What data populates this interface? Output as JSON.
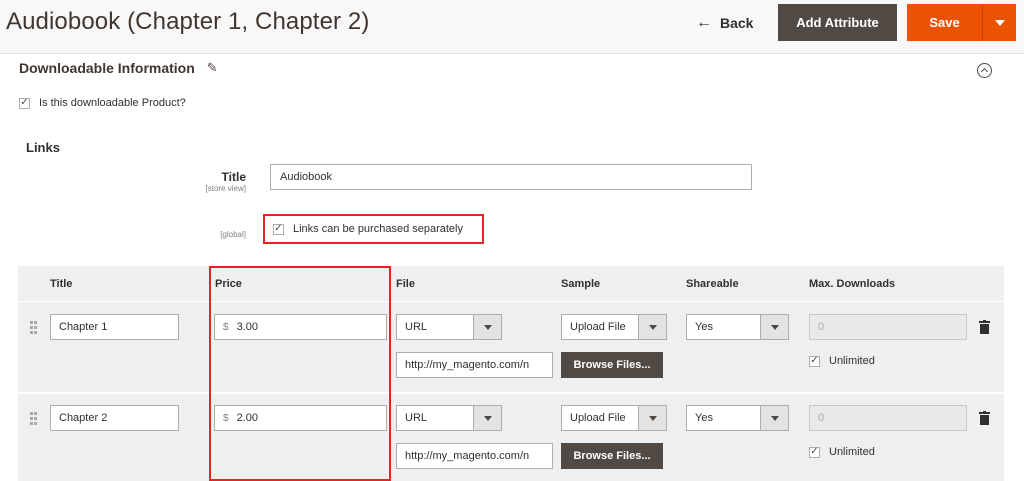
{
  "header": {
    "title": "Audiobook (Chapter 1, Chapter 2)",
    "back_label": "Back",
    "add_attribute_label": "Add Attribute",
    "save_label": "Save"
  },
  "section": {
    "title": "Downloadable Information",
    "is_downloadable_label": "Is this downloadable Product?",
    "is_downloadable_checked": true
  },
  "links": {
    "heading": "Links",
    "title_label": "Title",
    "title_scope": "[store view]",
    "title_value": "Audiobook",
    "global_scope": "[global]",
    "separately_label": "Links can be purchased separately",
    "separately_checked": true
  },
  "table": {
    "columns": [
      "Title",
      "Price",
      "File",
      "Sample",
      "Shareable",
      "Max. Downloads"
    ],
    "rows": [
      {
        "title": "Chapter 1",
        "currency": "$",
        "price": "3.00",
        "file_type": "URL",
        "file_url": "http://my_magento.com/n",
        "sample_type": "Upload File",
        "browse_label": "Browse Files...",
        "shareable": "Yes",
        "max_downloads": "0",
        "unlimited_label": "Unlimited",
        "unlimited_checked": true
      },
      {
        "title": "Chapter 2",
        "currency": "$",
        "price": "2.00",
        "file_type": "URL",
        "file_url": "http://my_magento.com/n",
        "sample_type": "Upload File",
        "browse_label": "Browse Files...",
        "shareable": "Yes",
        "max_downloads": "0",
        "unlimited_label": "Unlimited",
        "unlimited_checked": true
      }
    ]
  },
  "icons": {
    "back": "arrow-left-icon",
    "edit": "pencil-icon",
    "collapse": "chevron-up-circle-icon",
    "drag": "drag-handle-icon",
    "delete": "trash-icon",
    "dropdown": "triangle-down-icon"
  },
  "colors": {
    "primary_orange": "#eb5202",
    "dark_button": "#514943",
    "highlight_red": "#e22626"
  }
}
